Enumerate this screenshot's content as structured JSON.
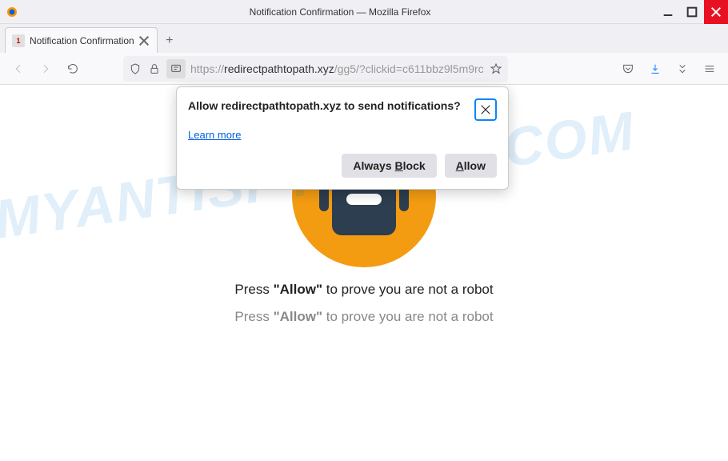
{
  "window": {
    "title": "Notification Confirmation — Mozilla Firefox"
  },
  "tab": {
    "label": "Notification Confirmation",
    "favicon_badge": "1"
  },
  "url": {
    "prefix": "https://",
    "domain": "redirectpathtopath.xyz",
    "path": "/gg5/?clickid=c611bbz9l5m9rc"
  },
  "permission": {
    "title": "Allow redirectpathtopath.xyz to send notifications?",
    "learn_more": "Learn more",
    "always_block_prefix": "Always ",
    "always_block_ul": "B",
    "always_block_suffix": "lock",
    "allow_ul": "A",
    "allow_suffix": "llow"
  },
  "page": {
    "line1_prefix": "Press ",
    "line1_bold": "\"Allow\"",
    "line1_suffix": " to prove you are not a robot",
    "line2_prefix": "Press ",
    "line2_bold": "\"Allow\"",
    "line2_suffix": " to prove you are not a robot"
  },
  "watermark": "MYANTISPYWARE.COM"
}
